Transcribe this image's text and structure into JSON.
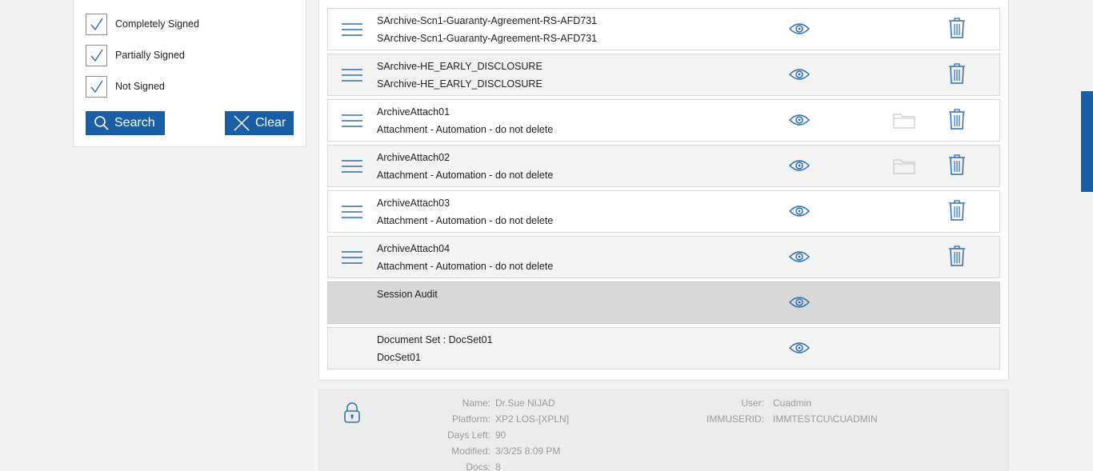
{
  "filters": {
    "checkboxes": [
      {
        "label": "Completely Signed",
        "checked": true
      },
      {
        "label": "Partially Signed",
        "checked": true
      },
      {
        "label": "Not Signed",
        "checked": true
      }
    ],
    "search_label": "Search",
    "clear_label": "Clear"
  },
  "documents": [
    {
      "line1": "SArchive-Scn1-Guaranty-Agreement-RS-AFD731",
      "line2": "SArchive-Scn1-Guaranty-Agreement-RS-AFD731",
      "handle": true,
      "folder": false,
      "trash": true,
      "style": "normal"
    },
    {
      "line1": "SArchive-HE_EARLY_DISCLOSURE",
      "line2": "SArchive-HE_EARLY_DISCLOSURE",
      "handle": true,
      "folder": false,
      "trash": true,
      "style": "alt"
    },
    {
      "line1": "ArchiveAttach01",
      "line2": "Attachment - Automation - do not delete",
      "handle": true,
      "folder": true,
      "trash": true,
      "style": "normal"
    },
    {
      "line1": "ArchiveAttach02",
      "line2": "Attachment - Automation - do not delete",
      "handle": true,
      "folder": true,
      "trash": true,
      "style": "alt"
    },
    {
      "line1": "ArchiveAttach03",
      "line2": "Attachment - Automation - do not delete",
      "handle": true,
      "folder": false,
      "trash": true,
      "style": "normal"
    },
    {
      "line1": "ArchiveAttach04",
      "line2": "Attachment - Automation - do not delete",
      "handle": true,
      "folder": false,
      "trash": true,
      "style": "alt"
    },
    {
      "line1": "Session Audit",
      "line2": "",
      "handle": false,
      "folder": false,
      "trash": false,
      "style": "audit"
    },
    {
      "line1": "Document Set : DocSet01",
      "line2": "DocSet01",
      "handle": false,
      "folder": false,
      "trash": false,
      "style": "alt"
    }
  ],
  "session_info": {
    "left": [
      {
        "label": "Name:",
        "value": "Dr.Sue NIJAD"
      },
      {
        "label": "Platform:",
        "value": "XP2 LOS-[XPLN]"
      },
      {
        "label": "Days Left:",
        "value": "90"
      },
      {
        "label": "Modified:",
        "value": "3/3/25 8:09 PM"
      },
      {
        "label": "Docs:",
        "value": "8"
      }
    ],
    "right": [
      {
        "label": "User:",
        "value": "Cuadmin"
      },
      {
        "label": "IMMUSERID:",
        "value": "IMMTESTCU\\CUADMIN"
      }
    ]
  },
  "colors": {
    "accent": "#1a5ea6",
    "icon_blue": "#2b6cb0"
  },
  "icons": {
    "handle": "hamburger-icon",
    "view": "eye-icon",
    "folder": "folder-icon",
    "delete": "trash-icon",
    "lock": "lock-icon",
    "search": "search-icon",
    "clear": "close-icon"
  }
}
